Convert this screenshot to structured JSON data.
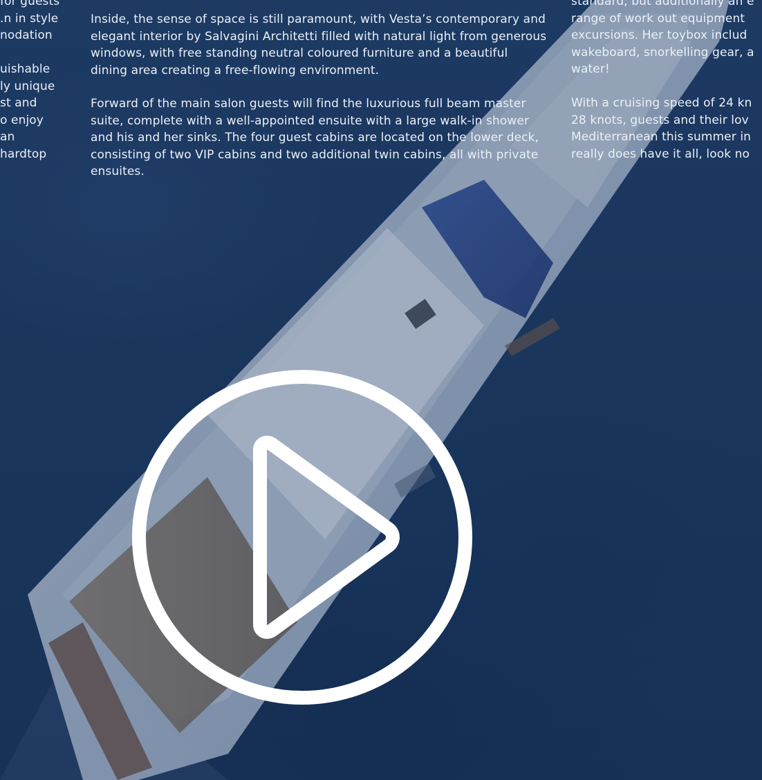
{
  "left_column": {
    "lines": [
      "for guests",
      "n in style.",
      "nodation",
      "",
      "uishable",
      "ly unique",
      "st and",
      "o enjoy",
      "an",
      " hardtop"
    ]
  },
  "middle_column": {
    "paragraph_1": "Inside, the sense of space is still paramount, with Vesta’s contemporary and elegant interior by Salvagini Architetti filled with natural light from generous windows, with free standing neutral coloured furniture and a beautiful dining area creating a free-flowing environment.",
    "paragraph_2": "Forward of the main salon guests will find the luxurious full beam master suite, complete with a well-appointed ensuite with a large walk-in shower and his and her sinks. The four guest cabins are located on the lower deck, consisting of two VIP cabins and two additional twin cabins, all with private ensuites."
  },
  "right_column": {
    "lines": [
      "standard, but additionally an e",
      "range of work out equipment",
      "excursions. Her toybox includ",
      "wakeboard, snorkelling gear, a",
      "water!",
      "",
      "With a cruising speed of 24 kn",
      "28 knots, guests and their lov",
      "Mediterranean this summer in",
      "really does have it all, look no"
    ]
  },
  "video": {
    "play_icon": "play-icon",
    "play_color": "#ffffff"
  },
  "colors": {
    "sea": "#1d3a60",
    "text": "#eaf0f7"
  }
}
